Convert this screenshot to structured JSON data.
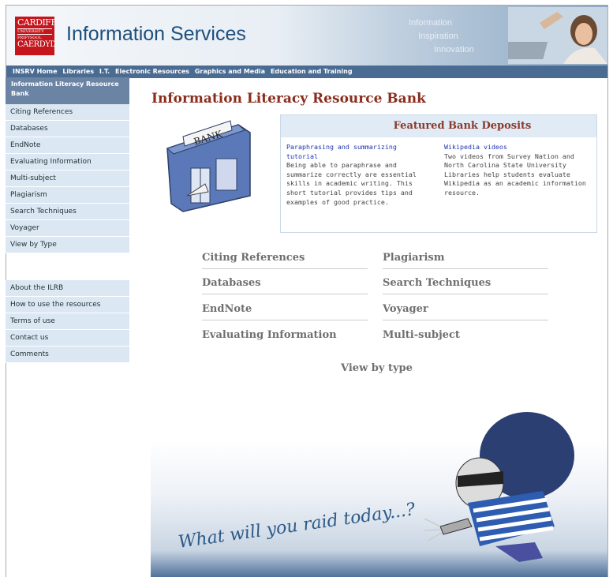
{
  "header": {
    "logo": {
      "line1": "CARDIFF",
      "line2": "UNIVERSITY",
      "line3": "PRIFYSGOL",
      "line4": "CAERDYD"
    },
    "title": "Information Services",
    "tagline": [
      "Information",
      "Inspiration",
      "Innovation"
    ]
  },
  "navbar": [
    "INSRV Home",
    "Libraries",
    "I.T.",
    "Electronic Resources",
    "Graphics and Media",
    "Education and Training"
  ],
  "sidebar": {
    "heading": "Information Literacy Resource Bank",
    "items": [
      "Citing References",
      "Databases",
      "EndNote",
      "Evaluating Information",
      "Multi-subject",
      "Plagiarism",
      "Search Techniques",
      "Voyager",
      "View by Type"
    ],
    "items2": [
      "About the ILRB",
      "How to use the resources",
      "Terms of use",
      "Contact us",
      "Comments"
    ]
  },
  "main": {
    "heading": "Information Literacy Resource Bank",
    "bank_sign": "BANK",
    "featured": {
      "heading": "Featured Bank Deposits",
      "deposits": [
        {
          "link": "Paraphrasing and summarizing tutorial",
          "text": "Being able to paraphrase and summarize correctly are essential skills in academic writing. This short tutorial provides tips and examples of good practice."
        },
        {
          "link": "Wikipedia videos",
          "text": "Two videos from Survey Nation and North Carolina State University Libraries help students evaluate Wikipedia as an academic information resource."
        }
      ]
    },
    "categories": [
      "Citing References",
      "Plagiarism",
      "Databases",
      "Search Techniques",
      "EndNote",
      "Voyager",
      "Evaluating Information",
      "Multi-subject"
    ],
    "view_by_type": "View by type",
    "raid_text": "What will you raid today...?"
  }
}
